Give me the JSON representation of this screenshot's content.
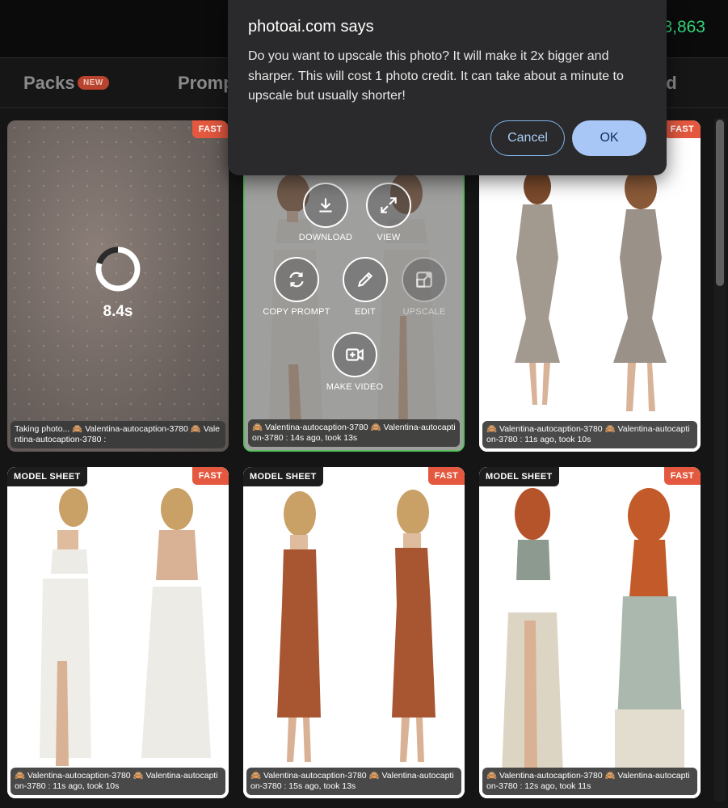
{
  "header": {
    "credits": "3,863"
  },
  "tabs": {
    "packs": "Packs",
    "packs_badge": "NEW",
    "prompts": "Promp",
    "right": "ed"
  },
  "cards": [
    {
      "fast": "FAST",
      "timer": "8.4s",
      "caption": "Taking photo... 🙈 Valentina-autocaption-3780 🙈 Valentina-autocaption-3780 :"
    },
    {
      "caption": "🙈 Valentina-autocaption-3780 🙈 Valentina-autocaption-3780 : 14s ago, took 13s",
      "actions": {
        "download": "DOWNLOAD",
        "view": "VIEW",
        "copy_prompt": "COPY PROMPT",
        "edit": "EDIT",
        "upscale": "UPSCALE",
        "make_video": "MAKE VIDEO"
      }
    },
    {
      "fast": "FAST",
      "caption": "🙈 Valentina-autocaption-3780 🙈 Valentina-autocaption-3780 : 11s ago, took 10s"
    },
    {
      "model": "MODEL SHEET",
      "fast": "FAST",
      "caption": "🙈 Valentina-autocaption-3780 🙈 Valentina-autocaption-3780 : 11s ago, took 10s"
    },
    {
      "model": "MODEL SHEET",
      "fast": "FAST",
      "caption": "🙈 Valentina-autocaption-3780 🙈 Valentina-autocaption-3780 : 15s ago, took 13s"
    },
    {
      "model": "MODEL SHEET",
      "fast": "FAST",
      "caption": "🙈 Valentina-autocaption-3780 🙈 Valentina-autocaption-3780 : 12s ago, took 11s"
    }
  ],
  "dialog": {
    "title": "photoai.com says",
    "message": "Do you want to upscale this photo? It will make it 2x bigger and sharper. This will cost 1 photo credit. It can take about a minute to upscale but usually shorter!",
    "cancel": "Cancel",
    "ok": "OK"
  }
}
